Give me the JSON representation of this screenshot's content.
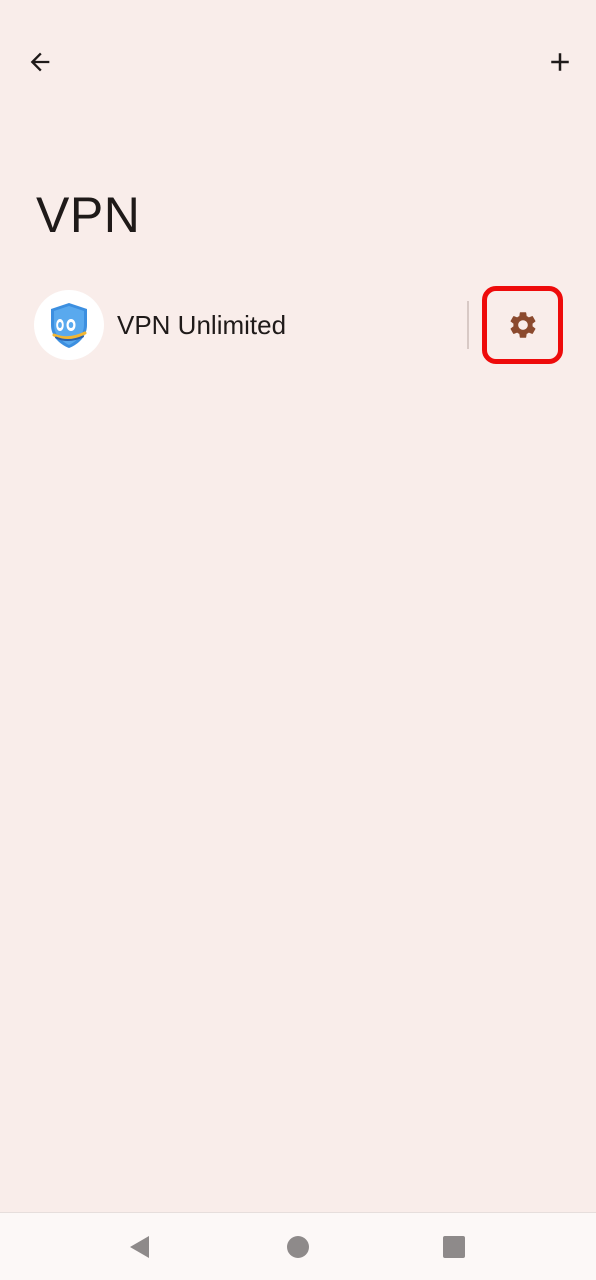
{
  "app_bar": {
    "back_icon": "arrow-left-icon",
    "add_icon": "plus-icon"
  },
  "page": {
    "title": "VPN"
  },
  "vpn_list": [
    {
      "label": "VPN Unlimited",
      "app_icon": "vpn-unlimited-shield-icon",
      "settings_icon": "gear-icon"
    }
  ],
  "highlight": {
    "color": "#EE0B0B"
  },
  "nav_bar": {
    "back_icon": "triangle-back-icon",
    "home_icon": "circle-home-icon",
    "recents_icon": "square-recents-icon"
  },
  "colors": {
    "background": "#F9EDEA",
    "text": "#1F1A19",
    "gear": "#8B4A2E",
    "nav_icons": "#8E8A8A"
  }
}
